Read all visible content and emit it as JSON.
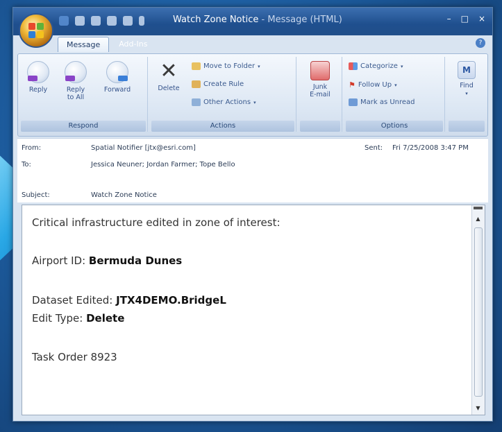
{
  "window": {
    "title": "Watch Zone Notice",
    "separator": "-",
    "type": "Message (HTML)",
    "controls": {
      "minimize": "–",
      "maximize": "□",
      "close": "×"
    }
  },
  "tabs": [
    "Message",
    "Add-Ins"
  ],
  "ribbon": {
    "respond": {
      "label": "Respond",
      "reply": "Reply",
      "reply_all_line1": "Reply",
      "reply_all_line2": "to All",
      "forward": "Forward"
    },
    "actions": {
      "label": "Actions",
      "delete": "Delete",
      "move_to_folder": "Move to Folder",
      "create_rule": "Create Rule",
      "other_actions": "Other Actions"
    },
    "junk": {
      "line1": "Junk",
      "line2": "E-mail"
    },
    "options": {
      "label": "Options",
      "categorize": "Categorize",
      "follow_up": "Follow Up",
      "mark_unread": "Mark as Unread"
    },
    "find": {
      "label": "Find"
    }
  },
  "header": {
    "from_label": "From:",
    "from_value": "Spatial Notifier [jtx@esri.com]",
    "sent_label": "Sent:",
    "sent_value": "Fri 7/25/2008 3:47 PM",
    "to_label": "To:",
    "to_value": "Jessica Neuner; Jordan Farmer; Tope Bello",
    "subject_label": "Subject:",
    "subject_value": "Watch Zone Notice"
  },
  "body": {
    "line1": "Critical infrastructure edited in zone of interest:",
    "airport_label": "Airport ID: ",
    "airport_value": "Bermuda Dunes",
    "dataset_label": "Dataset Edited: ",
    "dataset_value": "JTX4DEMO.BridgeL",
    "edit_type_label": "Edit Type: ",
    "edit_type_value": "Delete",
    "task_order": "Task Order 8923"
  },
  "colors": {
    "background": "#1d5c9e",
    "arrow": "#2aa8e6",
    "titlebar": "#1f4f8e",
    "ribbon": "#dbe6f3"
  }
}
